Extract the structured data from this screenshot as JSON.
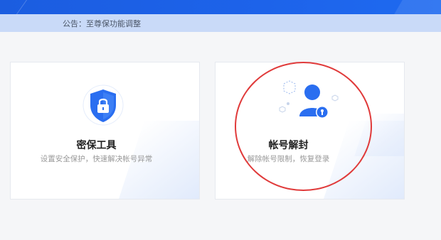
{
  "notice": {
    "text": "公告：至尊保功能调整"
  },
  "cards": [
    {
      "title": "密保工具",
      "subtitle": "设置安全保护，快速解决帐号异常",
      "icon": "shield-lock-icon"
    },
    {
      "title": "帐号解封",
      "subtitle": "解除帐号限制，恢复登录",
      "icon": "user-lock-icon"
    }
  ],
  "colors": {
    "brand": "#1d63ea",
    "notice_bg": "#c9daf8",
    "highlight": "#e03a3a"
  }
}
